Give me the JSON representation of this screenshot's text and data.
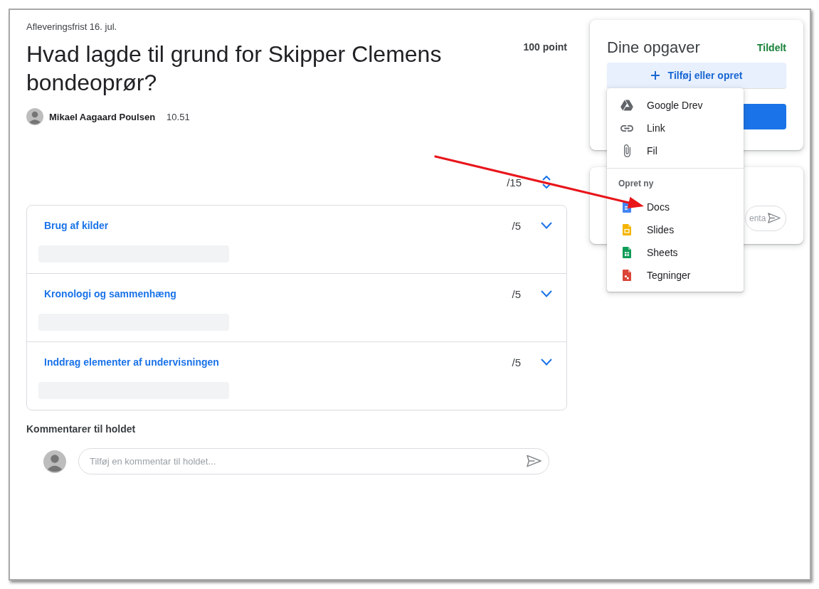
{
  "assignment": {
    "due": "Afleveringsfrist 16. jul.",
    "title": "Hvad lagde til grund for Skipper Clemens bondeoprør?",
    "points": "100 point",
    "author": "Mikael Aagaard Poulsen",
    "time": "10.51"
  },
  "rubric": {
    "total": "/15",
    "criteria": [
      {
        "title": "Brug af kilder",
        "score": "/5",
        "expanded": false
      },
      {
        "title": "Kronologi og sammenhæng",
        "score": "/5",
        "expanded": false
      },
      {
        "title": "Inddrag elementer af undervisningen",
        "score": "/5",
        "expanded": false
      }
    ]
  },
  "class_comments": {
    "heading": "Kommentarer til holdet",
    "placeholder": "Tilføj en kommentar til holdet..."
  },
  "your_work": {
    "title": "Dine opgaver",
    "status": "Tildelt",
    "add_button": "Tilføj eller opret"
  },
  "private_comments": {
    "placeholder": "enta"
  },
  "add_menu": {
    "items": [
      {
        "label": "Google Drev",
        "kind": "drive"
      },
      {
        "label": "Link",
        "kind": "link"
      },
      {
        "label": "Fil",
        "kind": "file"
      }
    ],
    "create_heading": "Opret ny",
    "create_items": [
      {
        "label": "Docs",
        "kind": "docs"
      },
      {
        "label": "Slides",
        "kind": "slides"
      },
      {
        "label": "Sheets",
        "kind": "sheets"
      },
      {
        "label": "Tegninger",
        "kind": "drawings"
      }
    ]
  }
}
